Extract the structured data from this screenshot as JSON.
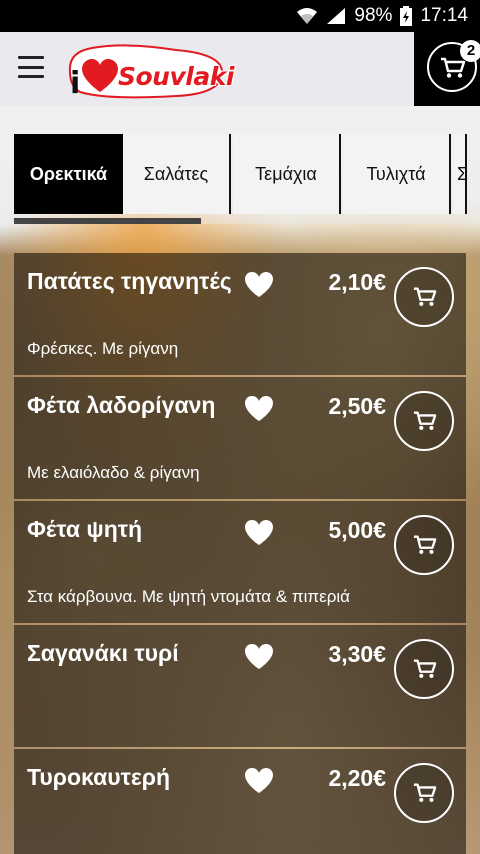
{
  "status_bar": {
    "battery": "98%",
    "time": "17:14",
    "icons": [
      "wifi-icon",
      "signal-icon",
      "battery-icon"
    ]
  },
  "app_bar": {
    "logo_prefix": "i",
    "logo_text": "Souvlaki",
    "cart_count": "2",
    "icons": [
      "menu-icon",
      "heart-logo-icon",
      "cart-icon"
    ]
  },
  "tabs": {
    "items": [
      "Ορεκτικά",
      "Σαλάτες",
      "Τεμάχια",
      "Τυλιχτά",
      "Σ"
    ],
    "active_index": 0
  },
  "menu": {
    "items": [
      {
        "name": "Πατάτες τηγανητές",
        "price": "2,10€",
        "desc": "Φρέσκες. Με ρίγανη"
      },
      {
        "name": "Φέτα λαδορίγανη",
        "price": "2,50€",
        "desc": "Με ελαιόλαδο & ρίγανη"
      },
      {
        "name": "Φέτα ψητή",
        "price": "5,00€",
        "desc": "Στα κάρβουνα. Με ψητή ντομάτα & πιπεριά"
      },
      {
        "name": "Σαγανάκι τυρί",
        "price": "3,30€",
        "desc": ""
      },
      {
        "name": "Τυροκαυτερή",
        "price": "2,20€",
        "desc": ""
      }
    ]
  },
  "colors": {
    "accent_logo": "#e21b23",
    "app_bar_bg": "#e9e9ee",
    "tab_active_bg": "#000000"
  }
}
